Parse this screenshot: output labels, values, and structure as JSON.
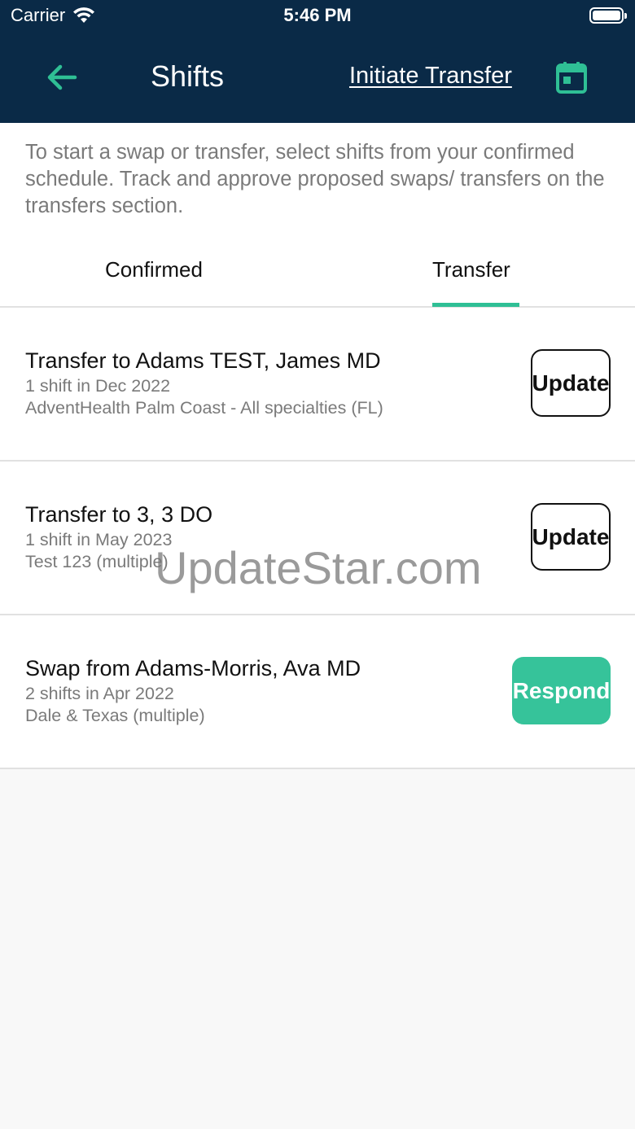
{
  "status_bar": {
    "carrier": "Carrier",
    "time": "5:46 PM"
  },
  "nav": {
    "title": "Shifts",
    "initiate_transfer": "Initiate Transfer",
    "accent": "#2fbf95",
    "background": "#0a2a47"
  },
  "intro_text": "To start a swap or transfer, select shifts from your confirmed schedule. Track and approve proposed swaps/ transfers on the transfers section.",
  "tabs": [
    {
      "label": "Confirmed",
      "active": false
    },
    {
      "label": "Transfer",
      "active": true
    }
  ],
  "items": [
    {
      "title": "Transfer to Adams TEST, James MD",
      "line1": "1 shift in Dec 2022",
      "line2": "AdventHealth Palm Coast - All specialties (FL)",
      "action": "Update"
    },
    {
      "title": "Transfer to 3, 3 DO",
      "line1": "1 shift in May 2023",
      "line2": "Test 123 (multiple)",
      "action": "Update"
    },
    {
      "title": "Swap from Adams-Morris, Ava MD",
      "line1": "2 shifts in Apr 2022",
      "line2": "Dale & Texas (multiple)",
      "action": "Respond"
    }
  ],
  "watermark": "UpdateStar.com"
}
